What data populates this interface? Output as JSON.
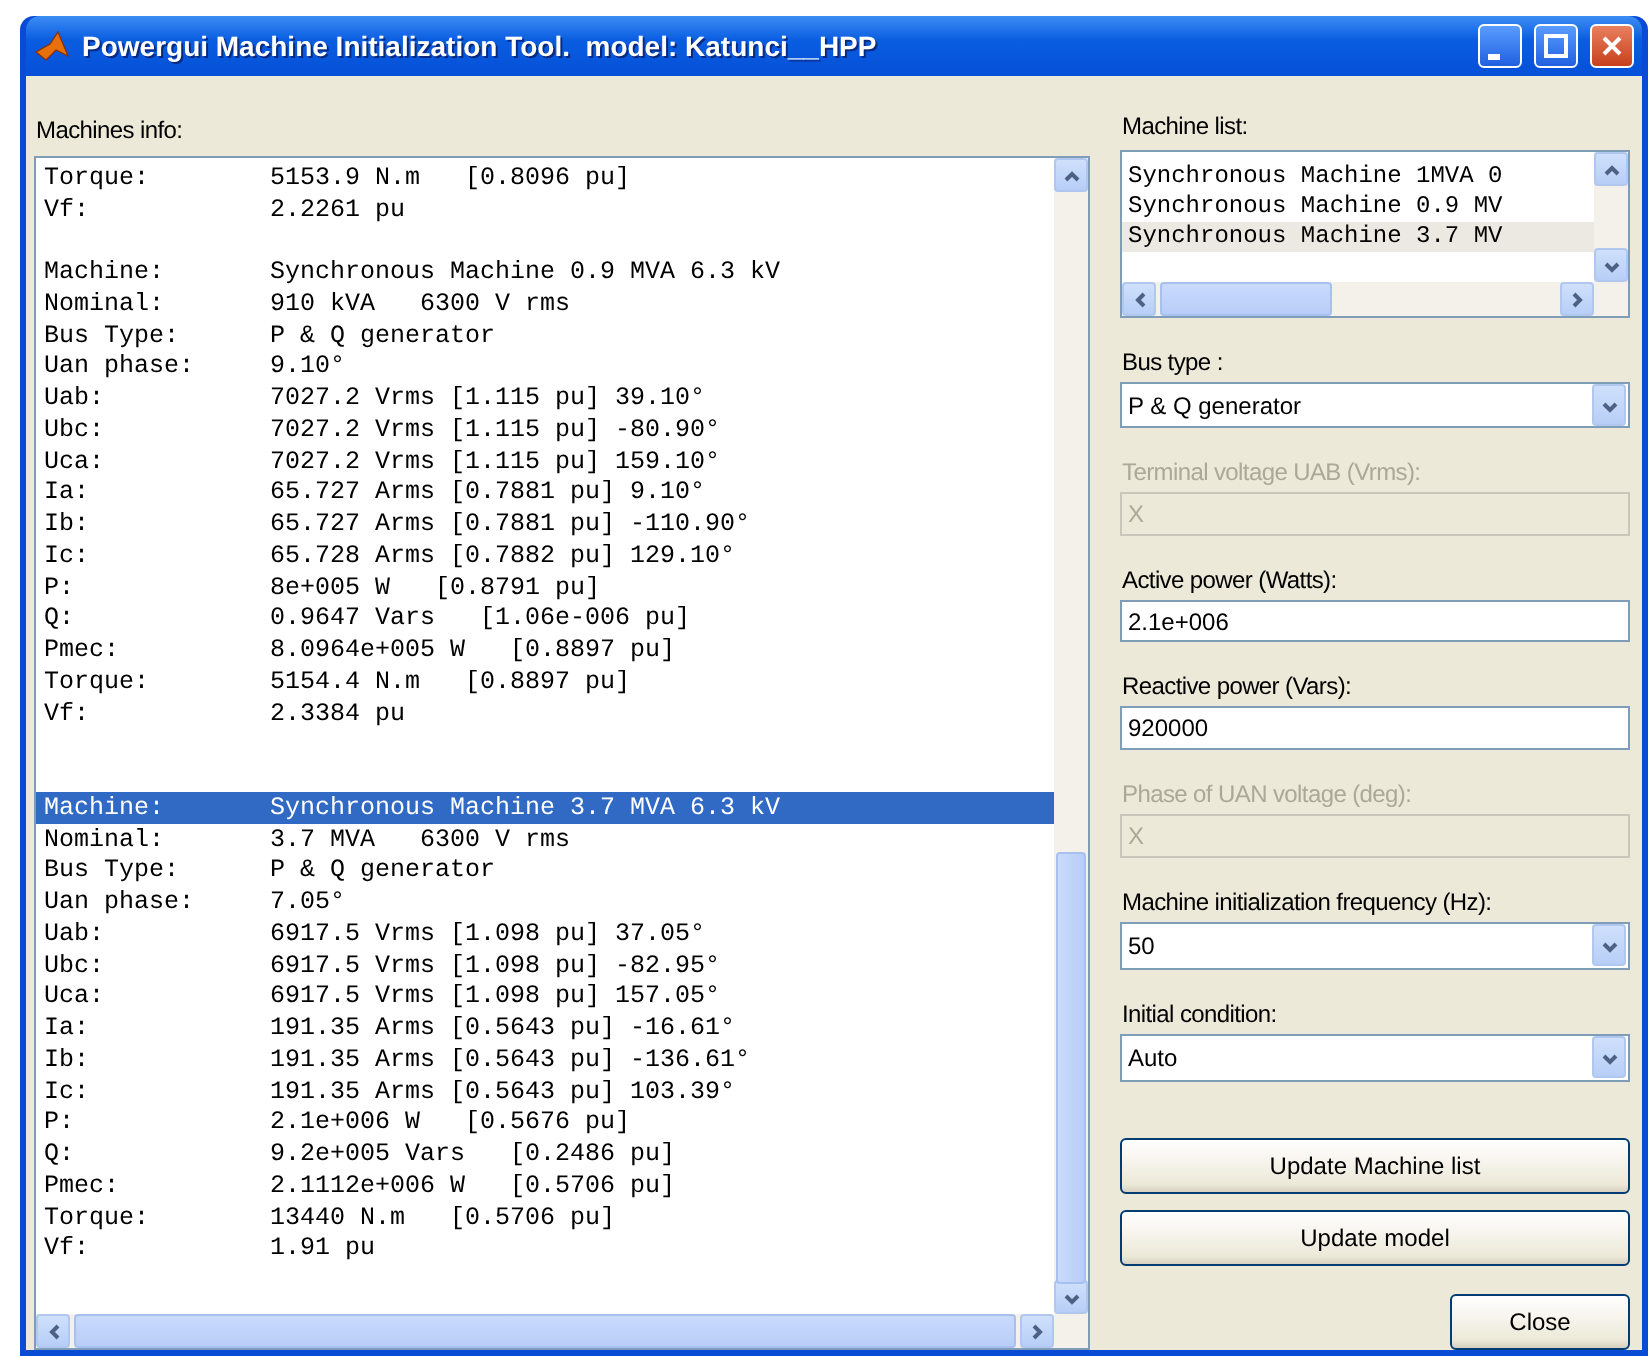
{
  "window": {
    "title": "Powergui Machine Initialization Tool.  model: Katunci__HPP"
  },
  "machines_info": {
    "label": "Machines info:",
    "lines": [
      {
        "kind": "text",
        "label": "Torque:",
        "value": "5153.9 N.m   [0.8096 pu]",
        "selected": false
      },
      {
        "kind": "text",
        "label": "Vf:",
        "value": "2.2261 pu",
        "selected": false
      },
      {
        "kind": "blank"
      },
      {
        "kind": "text",
        "label": "Machine:",
        "value": "Synchronous Machine 0.9 MVA 6.3 kV",
        "selected": false
      },
      {
        "kind": "text",
        "label": "Nominal:",
        "value": "910 kVA   6300 V rms",
        "selected": false
      },
      {
        "kind": "text",
        "label": "Bus Type:",
        "value": "P & Q generator",
        "selected": false
      },
      {
        "kind": "text",
        "label": "Uan phase:",
        "value": "9.10°",
        "selected": false
      },
      {
        "kind": "text",
        "label": "Uab:",
        "value": "7027.2 Vrms [1.115 pu] 39.10°",
        "selected": false
      },
      {
        "kind": "text",
        "label": "Ubc:",
        "value": "7027.2 Vrms [1.115 pu] -80.90°",
        "selected": false
      },
      {
        "kind": "text",
        "label": "Uca:",
        "value": "7027.2 Vrms [1.115 pu] 159.10°",
        "selected": false
      },
      {
        "kind": "text",
        "label": "Ia:",
        "value": "65.727 Arms [0.7881 pu] 9.10°",
        "selected": false
      },
      {
        "kind": "text",
        "label": "Ib:",
        "value": "65.727 Arms [0.7881 pu] -110.90°",
        "selected": false
      },
      {
        "kind": "text",
        "label": "Ic:",
        "value": "65.728 Arms [0.7882 pu] 129.10°",
        "selected": false
      },
      {
        "kind": "text",
        "label": "P:",
        "value": "8e+005 W   [0.8791 pu]",
        "selected": false
      },
      {
        "kind": "text",
        "label": "Q:",
        "value": "0.9647 Vars   [1.06e-006 pu]",
        "selected": false
      },
      {
        "kind": "text",
        "label": "Pmec:",
        "value": "8.0964e+005 W   [0.8897 pu]",
        "selected": false
      },
      {
        "kind": "text",
        "label": "Torque:",
        "value": "5154.4 N.m   [0.8897 pu]",
        "selected": false
      },
      {
        "kind": "text",
        "label": "Vf:",
        "value": "2.3384 pu",
        "selected": false
      },
      {
        "kind": "blank"
      },
      {
        "kind": "blank"
      },
      {
        "kind": "text",
        "label": "Machine:",
        "value": "Synchronous Machine 3.7 MVA 6.3 kV",
        "selected": true
      },
      {
        "kind": "text",
        "label": "Nominal:",
        "value": "3.7 MVA   6300 V rms",
        "selected": false
      },
      {
        "kind": "text",
        "label": "Bus Type:",
        "value": "P & Q generator",
        "selected": false
      },
      {
        "kind": "text",
        "label": "Uan phase:",
        "value": "7.05°",
        "selected": false
      },
      {
        "kind": "text",
        "label": "Uab:",
        "value": "6917.5 Vrms [1.098 pu] 37.05°",
        "selected": false
      },
      {
        "kind": "text",
        "label": "Ubc:",
        "value": "6917.5 Vrms [1.098 pu] -82.95°",
        "selected": false
      },
      {
        "kind": "text",
        "label": "Uca:",
        "value": "6917.5 Vrms [1.098 pu] 157.05°",
        "selected": false
      },
      {
        "kind": "text",
        "label": "Ia:",
        "value": "191.35 Arms [0.5643 pu] -16.61°",
        "selected": false
      },
      {
        "kind": "text",
        "label": "Ib:",
        "value": "191.35 Arms [0.5643 pu] -136.61°",
        "selected": false
      },
      {
        "kind": "text",
        "label": "Ic:",
        "value": "191.35 Arms [0.5643 pu] 103.39°",
        "selected": false
      },
      {
        "kind": "text",
        "label": "P:",
        "value": "2.1e+006 W   [0.5676 pu]",
        "selected": false
      },
      {
        "kind": "text",
        "label": "Q:",
        "value": "9.2e+005 Vars   [0.2486 pu]",
        "selected": false
      },
      {
        "kind": "text",
        "label": "Pmec:",
        "value": "2.1112e+006 W   [0.5706 pu]",
        "selected": false
      },
      {
        "kind": "text",
        "label": "Torque:",
        "value": "13440 N.m   [0.5706 pu]",
        "selected": false
      },
      {
        "kind": "text",
        "label": "Vf:",
        "value": "1.91 pu",
        "selected": false
      }
    ]
  },
  "machine_list": {
    "label": "Machine list:",
    "items": [
      {
        "text": "Synchronous Machine 1MVA 0",
        "selected": false
      },
      {
        "text": "Synchronous Machine 0.9 MV",
        "selected": false
      },
      {
        "text": "Synchronous Machine 3.7 MV",
        "selected": true
      }
    ]
  },
  "fields": [
    {
      "kind": "select",
      "label": "Bus type :",
      "value": "P & Q generator",
      "disabled": false
    },
    {
      "kind": "input",
      "label": "Terminal voltage UAB (Vrms):",
      "value": "X",
      "disabled": true
    },
    {
      "kind": "input",
      "label": "Active power (Watts):",
      "value": "2.1e+006",
      "disabled": false
    },
    {
      "kind": "input",
      "label": "Reactive power (Vars):",
      "value": "920000",
      "disabled": false
    },
    {
      "kind": "input",
      "label": "Phase of UAN voltage (deg):",
      "value": "X",
      "disabled": true
    },
    {
      "kind": "select",
      "label": "Machine initialization frequency (Hz):",
      "value": "50",
      "disabled": false
    },
    {
      "kind": "select",
      "label": "Initial condition:",
      "value": "Auto",
      "disabled": false
    }
  ],
  "buttons": [
    "Update Machine list",
    "Update model"
  ],
  "close_button": "Close"
}
